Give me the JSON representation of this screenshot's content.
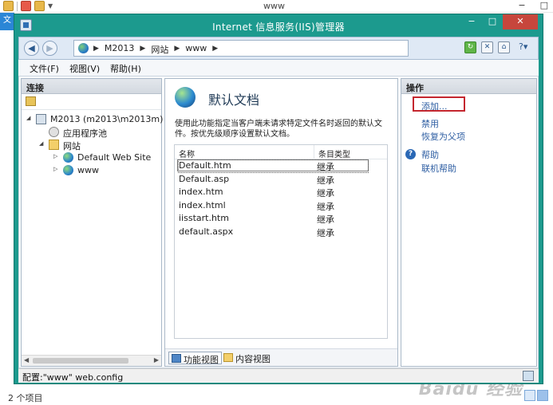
{
  "background_window": {
    "title": "www",
    "status_text": "2 个项目",
    "side_tab": "文",
    "controls": [
      "−",
      "□"
    ]
  },
  "watermark": "Baidu 经验",
  "iis": {
    "title": "Internet 信息服务(IIS)管理器",
    "window_controls": {
      "minimize": "−",
      "maximize": "□",
      "close": "✕"
    },
    "breadcrumb": [
      "M2013",
      "网站",
      "www"
    ],
    "menu": [
      "文件(F)",
      "视图(V)",
      "帮助(H)"
    ],
    "connections": {
      "header": "连接",
      "tree": [
        {
          "label": "M2013 (m2013\\m2013m)",
          "icon": "server-icon",
          "level": 0
        },
        {
          "label": "应用程序池",
          "icon": "app-pool-icon",
          "level": 1
        },
        {
          "label": "网站",
          "icon": "sites-folder-icon",
          "level": 1
        },
        {
          "label": "Default Web Site",
          "icon": "globe-icon",
          "level": 2
        },
        {
          "label": "www",
          "icon": "globe-icon",
          "level": 2
        }
      ]
    },
    "feature": {
      "title": "默认文档",
      "description": "使用此功能指定当客户端未请求特定文件名时返回的默认文件。按优先级顺序设置默认文档。",
      "columns": [
        "名称",
        "条目类型"
      ],
      "documents": [
        {
          "name": "Default.htm",
          "type": "继承"
        },
        {
          "name": "Default.asp",
          "type": "继承"
        },
        {
          "name": "index.htm",
          "type": "继承"
        },
        {
          "name": "index.html",
          "type": "继承"
        },
        {
          "name": "iisstart.htm",
          "type": "继承"
        },
        {
          "name": "default.aspx",
          "type": "继承"
        }
      ],
      "tabs": [
        "功能视图",
        "内容视图"
      ]
    },
    "actions": {
      "header": "操作",
      "add": "添加...",
      "disable": "禁用",
      "revert": "恢复为父项",
      "help": "帮助",
      "online_help": "联机帮助"
    },
    "status_text": "配置:\"www\" web.config"
  }
}
